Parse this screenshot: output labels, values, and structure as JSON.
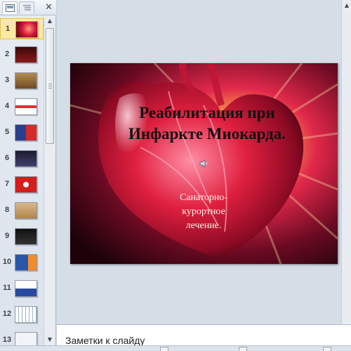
{
  "app": {
    "panel": {
      "tabs": [
        {
          "icon": "slides-tab-icon",
          "active": true
        },
        {
          "icon": "outline-tab-icon",
          "active": false
        }
      ],
      "close_icon": "✕",
      "thumbnails": [
        {
          "number": "1",
          "selected": true,
          "theme": "heart"
        },
        {
          "number": "2",
          "selected": false,
          "theme": "dark-red"
        },
        {
          "number": "3",
          "selected": false,
          "theme": "brown"
        },
        {
          "number": "4",
          "selected": false,
          "theme": "white-red"
        },
        {
          "number": "5",
          "selected": false,
          "theme": "blue-red"
        },
        {
          "number": "6",
          "selected": false,
          "theme": "dark-table"
        },
        {
          "number": "7",
          "selected": false,
          "theme": "red"
        },
        {
          "number": "8",
          "selected": false,
          "theme": "tan"
        },
        {
          "number": "9",
          "selected": false,
          "theme": "black"
        },
        {
          "number": "10",
          "selected": false,
          "theme": "blue-orange"
        },
        {
          "number": "11",
          "selected": false,
          "theme": "white-blue"
        },
        {
          "number": "12",
          "selected": false,
          "theme": "white-grid"
        },
        {
          "number": "13",
          "selected": false,
          "theme": "blank"
        }
      ]
    },
    "slide": {
      "title_line1": "Реабилитация при",
      "title_line2": "Инфаркте Миокарда.",
      "subtitle_line1": "Санаторно-",
      "subtitle_line2": "курортное",
      "subtitle_line3": "лечение.",
      "sound_icon": "speaker-icon"
    },
    "notes": {
      "placeholder": "Заметки к слайду"
    },
    "colors": {
      "selected_thumb": "#fbe9a4",
      "panel_bg": "#e6ebf2",
      "workspace_bg": "#d5dde7"
    }
  }
}
